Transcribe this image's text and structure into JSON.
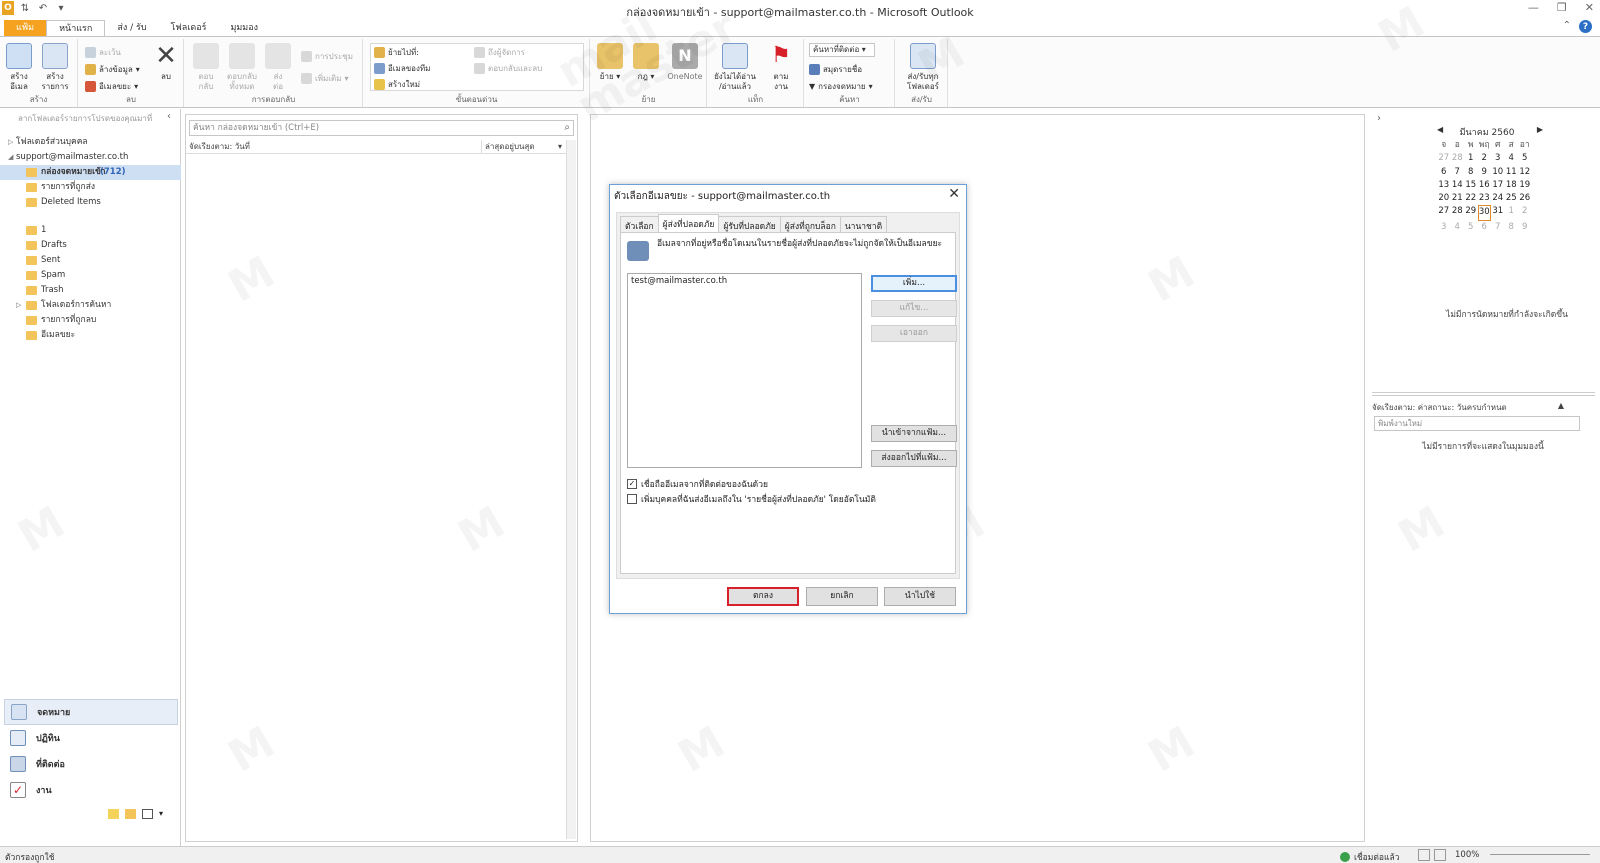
{
  "window": {
    "title": "กล่องจดหมายเข้า - support@mailmaster.co.th - Microsoft Outlook"
  },
  "ribbon_tabs": [
    "แฟ้ม",
    "หน้าแรก",
    "ส่ง / รับ",
    "โฟลเดอร์",
    "มุมมอง"
  ],
  "ribbon": {
    "new_email": "สร้าง\nอีเมล",
    "new_items": "สร้าง\nรายการ",
    "ignore": "ละเว้น",
    "cleanup": "ล้างข้อมูล",
    "junk": "อีเมลขยะ",
    "delete": "ลบ",
    "reply": "ตอบ\nกลับ",
    "reply_all": "ตอบกลับ\nทั้งหมด",
    "forward": "ส่ง\nต่อ",
    "meeting": "การประชุม",
    "more": "เพิ่มเติม",
    "move_to": "ย้ายไปที่:",
    "team_email": "อีเมลของทีม",
    "create_new": "สร้างใหม่",
    "to_manager": "ถึงผู้จัดการ",
    "reply_delete": "ตอบกลับและลบ",
    "move": "ย้าย",
    "rules": "กฎ",
    "onenote": "OneNote",
    "unread_read": "ยังไม่ได้อ่าน\n/อ่านแล้ว",
    "follow_up": "ตาม\nงาน",
    "find_contact": "ค้นหาที่ติดต่อ",
    "address_book": "สมุดรายชื่อ",
    "filter_email": "กรองจดหมาย",
    "send_receive_all": "ส่ง/รับทุก\nโฟลเดอร์",
    "groups": {
      "new": "สร้าง",
      "delete": "ลบ",
      "respond": "การตอบกลับ",
      "quick_steps": "ขั้นตอนด่วน",
      "move": "ย้าย",
      "tags": "แท็ก",
      "find": "ค้นหา",
      "send_receive": "ส่ง/รับ"
    }
  },
  "leftnav": {
    "favorites_hint": "ลากโฟลเดอร์รายการโปรดของคุณมาที่",
    "tree": [
      {
        "label": "โฟลเดอร์ส่วนบุคคล",
        "indent": 0,
        "arrow": "▷"
      },
      {
        "label": "support@mailmaster.co.th",
        "indent": 0,
        "arrow": "◢"
      },
      {
        "label": "กล่องจดหมายเข้า",
        "count": "(712)",
        "indent": 1,
        "selected": true
      },
      {
        "label": "รายการที่ถูกส่ง",
        "indent": 1
      },
      {
        "label": "Deleted Items",
        "indent": 1
      },
      {
        "label": "",
        "indent": 0
      },
      {
        "label": "1",
        "indent": 1
      },
      {
        "label": "Drafts",
        "indent": 1
      },
      {
        "label": "Sent",
        "indent": 1
      },
      {
        "label": "Spam",
        "indent": 1
      },
      {
        "label": "Trash",
        "indent": 1
      },
      {
        "label": "โฟลเดอร์การค้นหา",
        "indent": 1,
        "arrow": "▷"
      },
      {
        "label": "รายการที่ถูกลบ",
        "indent": 1
      },
      {
        "label": "อีเมลขยะ",
        "indent": 1
      }
    ],
    "panes": [
      "จดหมาย",
      "ปฏิทิน",
      "ที่ติดต่อ",
      "งาน"
    ]
  },
  "msglist": {
    "search_placeholder": "ค้นหา กล่องจดหมายเข้า (Ctrl+E)",
    "sort_by": "จัดเรียงตาม: วันที่",
    "order": "ล่าสุดอยู่บนสุด"
  },
  "calendar": {
    "month": "มีนาคม 2560",
    "dow": [
      "จ",
      "อ",
      "พ",
      "พฤ",
      "ศ",
      "ส",
      "อา"
    ],
    "weeks": [
      [
        "27",
        "28",
        "1",
        "2",
        "3",
        "4",
        "5"
      ],
      [
        "6",
        "7",
        "8",
        "9",
        "10",
        "11",
        "12"
      ],
      [
        "13",
        "14",
        "15",
        "16",
        "17",
        "18",
        "19"
      ],
      [
        "20",
        "21",
        "22",
        "23",
        "24",
        "25",
        "26"
      ],
      [
        "27",
        "28",
        "29",
        "30",
        "31",
        "1",
        "2"
      ],
      [
        "3",
        "4",
        "5",
        "6",
        "7",
        "8",
        "9"
      ]
    ],
    "today": "30",
    "no_appointments": "ไม่มีการนัดหมายที่กำลังจะเกิดขึ้น"
  },
  "tasks": {
    "header": "จัดเรียงตาม: ค่าสถานะ: วันครบกำหนด",
    "type_placeholder": "พิมพ์งานใหม่",
    "empty": "ไม่มีรายการที่จะแสดงในมุมมองนี้"
  },
  "statusbar": {
    "filter": "ตัวกรองถูกใช้",
    "connection": "เชื่อมต่อแล้ว",
    "zoom": "100%"
  },
  "watermark": "mail\nmaster",
  "dialog": {
    "title": "ตัวเลือกอีเมลขยะ - support@mailmaster.co.th",
    "tabs": [
      "ตัวเลือก",
      "ผู้ส่งที่ปลอดภัย",
      "ผู้รับที่ปลอดภัย",
      "ผู้ส่งที่ถูกบล็อก",
      "นานาชาติ"
    ],
    "info": "อีเมลจากที่อยู่หรือชื่อโดเมนในรายชื่อผู้ส่งที่ปลอดภัยจะไม่ถูกจัดให้เป็นอีเมลขยะ",
    "addresses": [
      "test@mailmaster.co.th"
    ],
    "buttons": {
      "add": "เพิ่ม...",
      "edit": "แก้ไข...",
      "remove": "เอาออก",
      "import": "นำเข้าจากแฟ้ม...",
      "export": "ส่งออกไปที่แฟ้ม..."
    },
    "check1": "เชื่อถืออีเมลจากที่ติดต่อของฉันด้วย",
    "check1_checked": true,
    "check2": "เพิ่มบุคคลที่ฉันส่งอีเมลถึงใน 'รายชื่อผู้ส่งที่ปลอดภัย' โดยอัตโนมัติ",
    "check2_checked": false,
    "footer": {
      "ok": "ตกลง",
      "cancel": "ยกเลิก",
      "apply": "นำไปใช้"
    }
  }
}
